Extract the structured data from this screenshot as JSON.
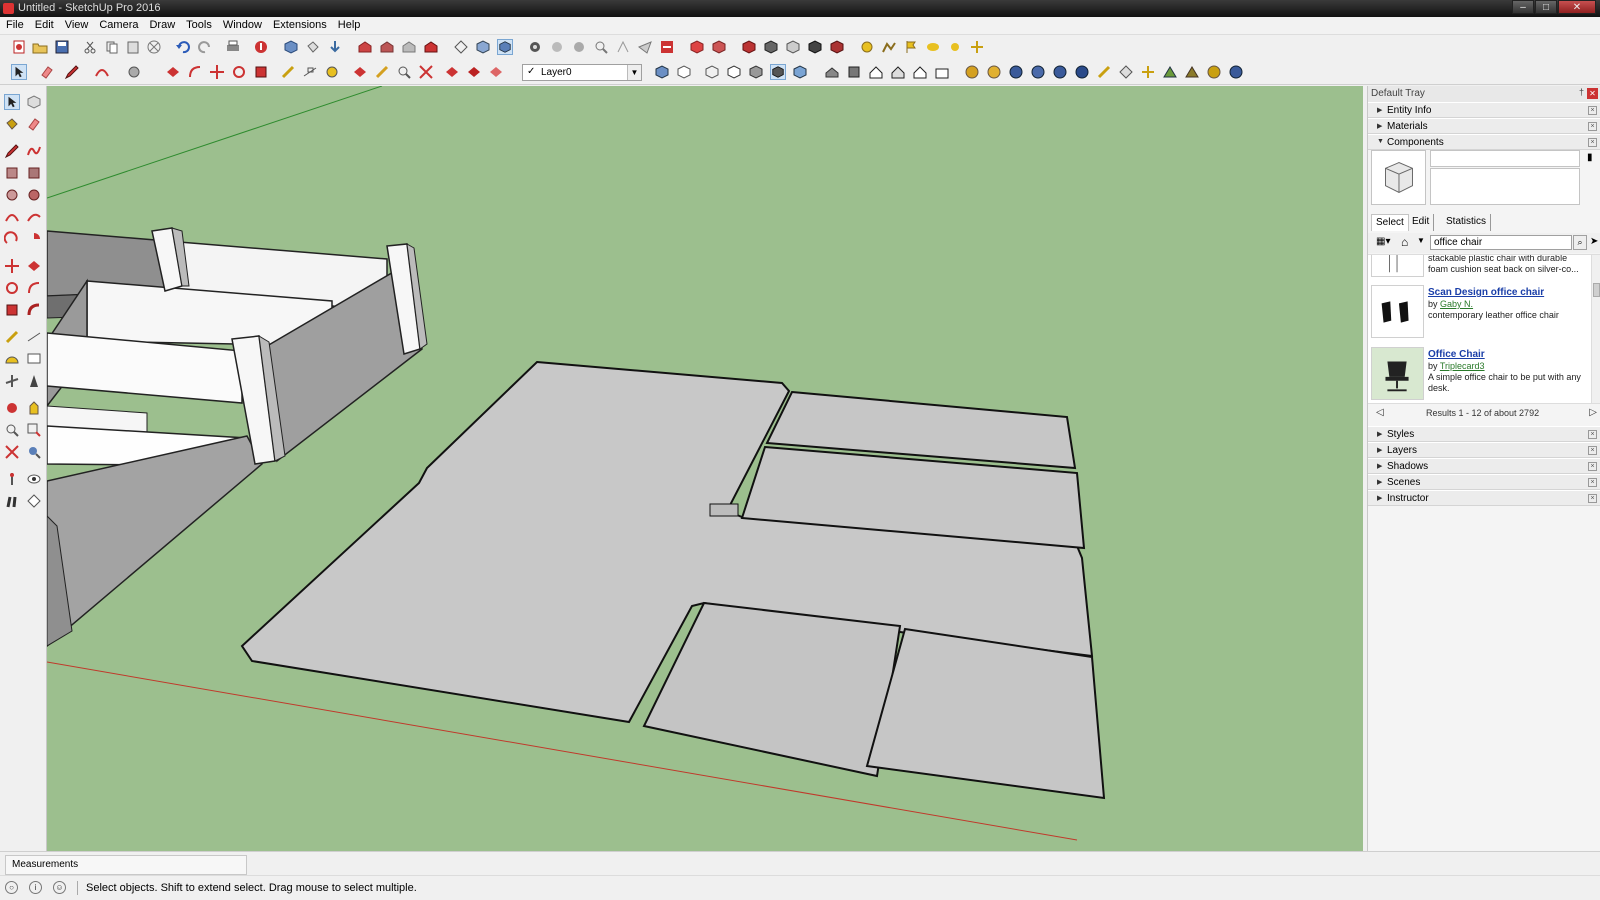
{
  "window": {
    "title": "Untitled - SketchUp Pro 2016",
    "min": "–",
    "max": "□",
    "close": "✕"
  },
  "menu": [
    "File",
    "Edit",
    "View",
    "Camera",
    "Draw",
    "Tools",
    "Window",
    "Extensions",
    "Help"
  ],
  "layer": {
    "check": "✓",
    "current": "Layer0",
    "arrow": "▼"
  },
  "tray": {
    "title": "Default Tray",
    "pin": "†",
    "close": "✕",
    "panels_top": [
      {
        "label": "Entity Info",
        "state": "▶"
      },
      {
        "label": "Materials",
        "state": "▶"
      },
      {
        "label": "Components",
        "state": "▼"
      }
    ],
    "panels_bottom": [
      {
        "label": "Styles",
        "state": "▶"
      },
      {
        "label": "Layers",
        "state": "▶"
      },
      {
        "label": "Shadows",
        "state": "▶"
      },
      {
        "label": "Scenes",
        "state": "▶"
      },
      {
        "label": "Instructor",
        "state": "▶"
      }
    ],
    "panel_close": "×"
  },
  "components": {
    "tabs": [
      "Select",
      "Edit",
      "Statistics"
    ],
    "search_value": "office chair",
    "search_btn": "⌕",
    "results": [
      {
        "title": "",
        "by_prefix": "",
        "author": "",
        "desc": "stackable plastic chair with durable foam cushion seat  back on silver-co..."
      },
      {
        "title": "Scan Design office chair",
        "by_prefix": "by",
        "author": "Gaby N.",
        "desc": "contemporary leather office chair"
      },
      {
        "title": "Office Chair",
        "by_prefix": "by",
        "author": "Triplecard3",
        "desc": "A simple office chair to be put with any desk."
      }
    ],
    "results_count": "Results 1 - 12 of about 2792",
    "prev": "◁",
    "next": "▷"
  },
  "status": {
    "measurements_label": "Measurements",
    "message": "Select objects. Shift to extend select. Drag mouse to select multiple.",
    "icon_geo": "○",
    "icon_info": "i",
    "icon_user": "☺"
  },
  "colors": {
    "viewport_bg": "#9cbf8e",
    "model_face": "#c8c8c8",
    "wall_side": "#a3a3a3",
    "axis_red": "#c0392b",
    "axis_green": "#2e8b2e"
  }
}
